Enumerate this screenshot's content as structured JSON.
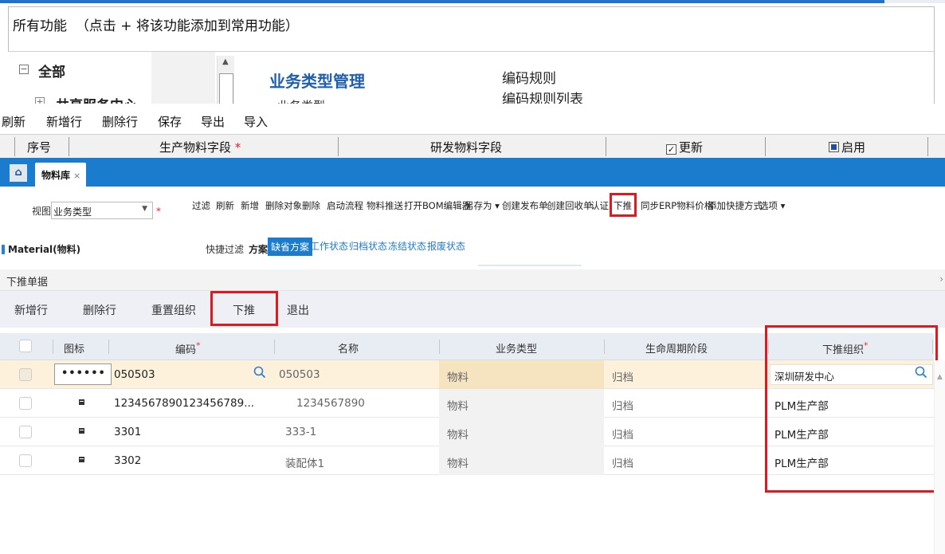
{
  "all_functions": {
    "title": "所有功能",
    "hint": "（点击 + 将该功能添加到常用功能）",
    "tree": {
      "expander_all": "−",
      "all": "全部",
      "expander_share": "+",
      "share_center": "共享服务中心"
    },
    "category": {
      "title": "业务类型管理",
      "sub": "业务类型"
    },
    "rules": [
      "编码规则",
      "编码规则列表"
    ]
  },
  "grid_toolbar": {
    "buttons": [
      "刷新",
      "新增行",
      "删除行",
      "保存",
      "导出",
      "导入"
    ],
    "columns": {
      "seq": "序号",
      "production_field": "生产物料字段",
      "required_mark": "*",
      "rd_field": "研发物料字段",
      "update": "更新",
      "enable": "启用"
    },
    "update_checked": true,
    "enable_checked": true
  },
  "material_tab": {
    "home_icon": "home-icon",
    "tab_label": "物料库",
    "tab_close": "×",
    "view_label": "视图:",
    "view_value": "业务类型",
    "view_required": "*",
    "actions": [
      "过滤",
      "刷新",
      "新增",
      "删除对象",
      "删除",
      "启动流程",
      "物料推送",
      "打开BOM编辑器",
      "另存为 ▾",
      "创建发布单",
      "创建回收单",
      "认证",
      "下推",
      "同步ERP物料价格",
      "添加快捷方式",
      "选项 ▾"
    ],
    "tree_node": "Material(物料)",
    "quick_filter": "快捷过滤",
    "scheme_label": "方案:",
    "schemes": [
      "缺省方案",
      "工作状态",
      "归档状态",
      "冻结状态",
      "报废状态"
    ],
    "active_scheme": "缺省方案"
  },
  "push_dialog": {
    "title": "下推单据",
    "chevron": "›",
    "buttons": {
      "add_row": "新增行",
      "delete_row": "删除行",
      "reset_org": "重置组织",
      "push": "下推",
      "exit": "退出"
    },
    "columns": {
      "icon": "图标",
      "code": "编码",
      "name": "名称",
      "biz_type": "业务类型",
      "lifecycle": "生命周期阶段",
      "push_org": "下推组织"
    },
    "required_mark": "*",
    "rows": [
      {
        "icon": "",
        "password": "••••••",
        "code": "050503",
        "name": "050503",
        "biz_type": "物料",
        "lifecycle": "归档",
        "push_org": "深圳研发中心",
        "selected": true
      },
      {
        "icon": "document-icon",
        "code": "1234567890123456789...",
        "name": "1234567890",
        "biz_type": "物料",
        "lifecycle": "归档",
        "push_org": "PLM生产部"
      },
      {
        "icon": "document-icon",
        "code": "3301",
        "name": "333-1",
        "biz_type": "物料",
        "lifecycle": "归档",
        "push_org": "PLM生产部"
      },
      {
        "icon": "document-icon",
        "code": "3302",
        "name": "装配体1",
        "biz_type": "物料",
        "lifecycle": "归档",
        "push_org": "PLM生产部"
      }
    ]
  },
  "colors": {
    "accent_blue": "#1b7ccd",
    "highlight_red": "#e0191e",
    "selected_row": "#fdf1dc"
  }
}
